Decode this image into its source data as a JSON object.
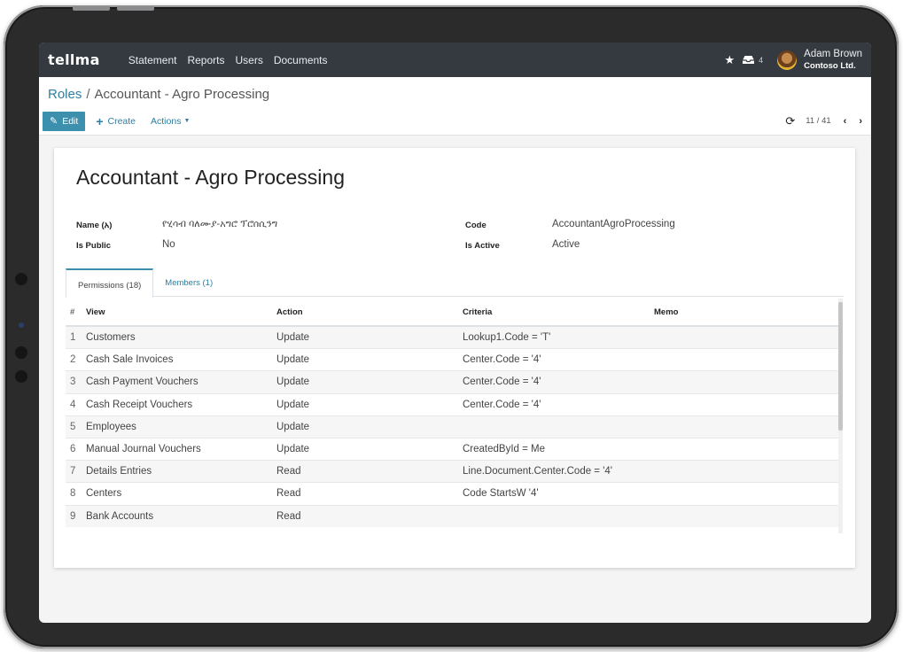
{
  "navbar": {
    "brand": "tellma",
    "links": [
      "Statement",
      "Reports",
      "Users",
      "Documents"
    ],
    "inbox_count": "4",
    "user_name": "Adam Brown",
    "company": "Contoso Ltd."
  },
  "breadcrumb": {
    "parent": "Roles",
    "separator": "/",
    "current": "Accountant - Agro Processing"
  },
  "toolbar": {
    "edit_label": "Edit",
    "create_label": "Create",
    "actions_label": "Actions",
    "pager": "11 / 41"
  },
  "record": {
    "title": "Accountant - Agro Processing",
    "fields": {
      "name_label": "Name (አ)",
      "name_value": "የሂሳብ ባለሙያ-አግሮ ፕሮሰሲንግ",
      "code_label": "Code",
      "code_value": "AccountantAgroProcessing",
      "is_public_label": "Is Public",
      "is_public_value": "No",
      "is_active_label": "Is Active",
      "is_active_value": "Active"
    }
  },
  "tabs": [
    "Permissions (18)",
    "Members (1)"
  ],
  "grid": {
    "headers": {
      "num": "#",
      "view": "View",
      "action": "Action",
      "criteria": "Criteria",
      "memo": "Memo"
    },
    "rows": [
      {
        "num": "1",
        "view": "Customers",
        "action": "Update",
        "criteria": "Lookup1.Code = 'T'",
        "memo": ""
      },
      {
        "num": "2",
        "view": "Cash Sale Invoices",
        "action": "Update",
        "criteria": "Center.Code = '4'",
        "memo": ""
      },
      {
        "num": "3",
        "view": "Cash Payment Vouchers",
        "action": "Update",
        "criteria": "Center.Code = '4'",
        "memo": ""
      },
      {
        "num": "4",
        "view": "Cash Receipt Vouchers",
        "action": "Update",
        "criteria": "Center.Code = '4'",
        "memo": ""
      },
      {
        "num": "5",
        "view": "Employees",
        "action": "Update",
        "criteria": "",
        "memo": ""
      },
      {
        "num": "6",
        "view": "Manual Journal Vouchers",
        "action": "Update",
        "criteria": "CreatedById = Me",
        "memo": ""
      },
      {
        "num": "7",
        "view": "Details Entries",
        "action": "Read",
        "criteria": "Line.Document.Center.Code = '4'",
        "memo": ""
      },
      {
        "num": "8",
        "view": "Centers",
        "action": "Read",
        "criteria": "Code StartsW '4'",
        "memo": ""
      },
      {
        "num": "9",
        "view": "Bank Accounts",
        "action": "Read",
        "criteria": "",
        "memo": ""
      }
    ]
  },
  "icons": {
    "edit": "pencil-icon",
    "create": "plus-icon",
    "star": "star-icon",
    "inbox": "inbox-icon",
    "refresh": "refresh-icon",
    "prev": "chevron-left-icon",
    "next": "chevron-right-icon"
  },
  "colors": {
    "navbar_bg": "#343a40",
    "accent": "#3d8fae",
    "link": "#2f7ea0"
  }
}
